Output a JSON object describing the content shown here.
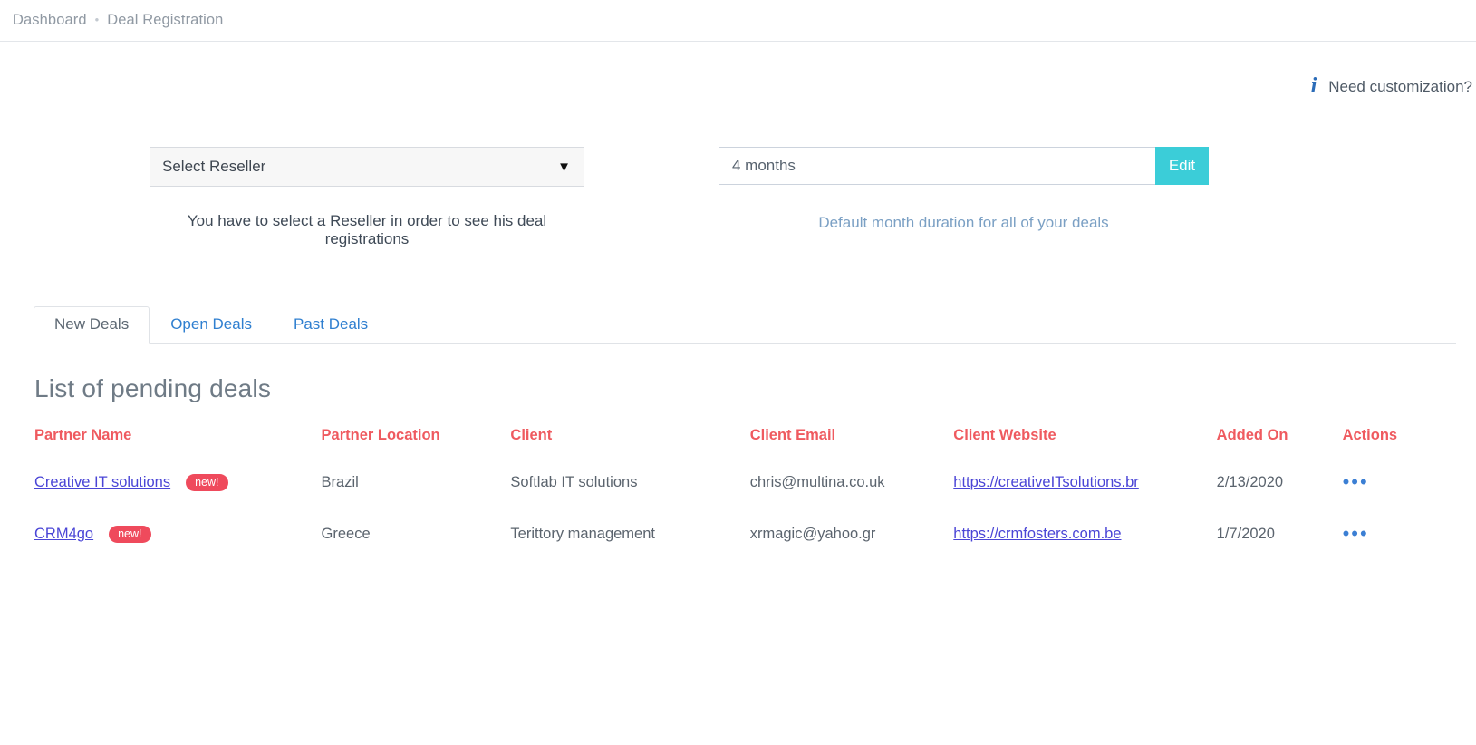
{
  "breadcrumb": {
    "items": [
      "Dashboard",
      "Deal Registration"
    ],
    "separator": "•"
  },
  "customization": {
    "icon": "info-icon",
    "label": "Need customization?"
  },
  "reseller_control": {
    "selected": "Select Reseller",
    "caret": "▼",
    "helper": "You have to select a Reseller in order to see his deal registrations"
  },
  "duration_control": {
    "value": "4 months",
    "placeholder": "4 months",
    "edit_label": "Edit",
    "helper": "Default month duration for all of your deals",
    "accent_color": "#3bcdd8"
  },
  "tabs": [
    {
      "label": "New Deals",
      "active": true
    },
    {
      "label": "Open Deals",
      "active": false
    },
    {
      "label": "Past Deals",
      "active": false
    }
  ],
  "table": {
    "title": "List of pending deals",
    "headers": [
      "Partner Name",
      "Partner Location",
      "Client",
      "Client Email",
      "Client Website",
      "Added On",
      "Actions"
    ],
    "header_color": "#ef5a5f",
    "rows": [
      {
        "partner_name": "Creative IT solutions",
        "badge": "new!",
        "partner_location": "Brazil",
        "client": "Softlab IT solutions",
        "client_email": "chris@multina.co.uk",
        "client_website": "https://creativeITsolutions.br",
        "added_on": "2/13/2020",
        "actions": "•••"
      },
      {
        "partner_name": "CRM4go",
        "badge": "new!",
        "partner_location": "Greece",
        "client": "Terittory management",
        "client_email": "xrmagic@yahoo.gr",
        "client_website": "https://crmfosters.com.be",
        "added_on": "1/7/2020",
        "actions": "•••"
      }
    ]
  }
}
